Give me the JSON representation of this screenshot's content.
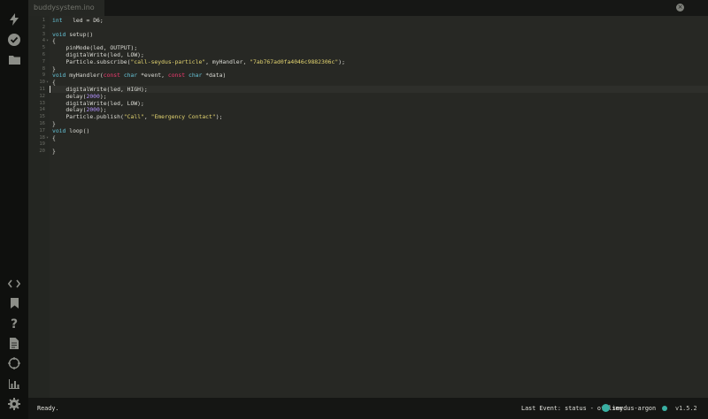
{
  "tab": {
    "filename": "buddysystem.ino",
    "close_glyph": "×"
  },
  "editor": {
    "lines": [
      {
        "n": "1",
        "fold": "",
        "parts": [
          [
            "kw",
            "int"
          ],
          [
            "",
            "   led = "
          ],
          [
            "",
            "D6;"
          ]
        ]
      },
      {
        "n": "2",
        "fold": "",
        "parts": []
      },
      {
        "n": "3",
        "fold": "",
        "parts": [
          [
            "kw",
            "void"
          ],
          [
            "",
            " setup()"
          ]
        ]
      },
      {
        "n": "4",
        "fold": "▾",
        "parts": [
          [
            "",
            "{"
          ]
        ]
      },
      {
        "n": "5",
        "fold": "",
        "parts": [
          [
            "",
            "    pinMode(led, OUTPUT);"
          ]
        ]
      },
      {
        "n": "6",
        "fold": "",
        "parts": [
          [
            "",
            "    digitalWrite(led, LOW);"
          ]
        ]
      },
      {
        "n": "7",
        "fold": "",
        "parts": [
          [
            "",
            "    Particle.subscribe("
          ],
          [
            "str",
            "\"call-seydus-particle\""
          ],
          [
            "",
            ", myHandler, "
          ],
          [
            "str",
            "\"7ab767ad0fa4046c9882306c\""
          ],
          [
            "",
            ");"
          ]
        ]
      },
      {
        "n": "8",
        "fold": "",
        "parts": [
          [
            "",
            "}"
          ]
        ]
      },
      {
        "n": "9",
        "fold": "",
        "parts": [
          [
            "kw",
            "void"
          ],
          [
            "",
            " myHandler("
          ],
          [
            "red",
            "const"
          ],
          [
            "",
            " "
          ],
          [
            "kw",
            "char"
          ],
          [
            "",
            " *event, "
          ],
          [
            "red",
            "const"
          ],
          [
            "",
            " "
          ],
          [
            "kw",
            "char"
          ],
          [
            "",
            " *data)"
          ]
        ]
      },
      {
        "n": "10",
        "fold": "▾",
        "parts": [
          [
            "",
            "{"
          ]
        ]
      },
      {
        "n": "11",
        "fold": "",
        "parts": [
          [
            "",
            "    digitalWrite(led, HIGH);"
          ]
        ]
      },
      {
        "n": "12",
        "fold": "",
        "parts": [
          [
            "",
            "    delay("
          ],
          [
            "num",
            "2000"
          ],
          [
            "",
            ");"
          ]
        ]
      },
      {
        "n": "13",
        "fold": "",
        "parts": [
          [
            "",
            "    digitalWrite(led, LOW);"
          ]
        ]
      },
      {
        "n": "14",
        "fold": "",
        "parts": [
          [
            "",
            "    delay("
          ],
          [
            "num",
            "2000"
          ],
          [
            "",
            ");"
          ]
        ]
      },
      {
        "n": "15",
        "fold": "",
        "parts": [
          [
            "",
            "    Particle.publish("
          ],
          [
            "str",
            "\"Call\""
          ],
          [
            "",
            ", "
          ],
          [
            "str",
            "\"Emergency Contact\""
          ],
          [
            "",
            ");"
          ]
        ]
      },
      {
        "n": "16",
        "fold": "",
        "parts": [
          [
            "",
            "}"
          ]
        ]
      },
      {
        "n": "17",
        "fold": "",
        "parts": [
          [
            "kw",
            "void"
          ],
          [
            "",
            " loop()"
          ]
        ]
      },
      {
        "n": "18",
        "fold": "▾",
        "parts": [
          [
            "",
            "{"
          ]
        ]
      },
      {
        "n": "19",
        "fold": "",
        "parts": []
      },
      {
        "n": "20",
        "fold": "",
        "parts": [
          [
            "",
            "}"
          ]
        ]
      }
    ]
  },
  "rail": {
    "top_icons": [
      "flash-icon",
      "verify-icon",
      "folder-icon"
    ],
    "bottom_icons": [
      "code-icon",
      "bookmark-icon",
      "help-icon",
      "document-icon",
      "target-icon",
      "chart-icon",
      "gear-icon"
    ]
  },
  "status": {
    "left": "Ready.",
    "event": "Last Event: status - offline",
    "device": "seydus-argon",
    "version": "v1.5.2"
  },
  "colors": {
    "accent": "#39b0a3",
    "keyword": "#66c3d6",
    "string": "#e3d470",
    "number": "#b594ff",
    "modifier": "#ef3a6f"
  }
}
